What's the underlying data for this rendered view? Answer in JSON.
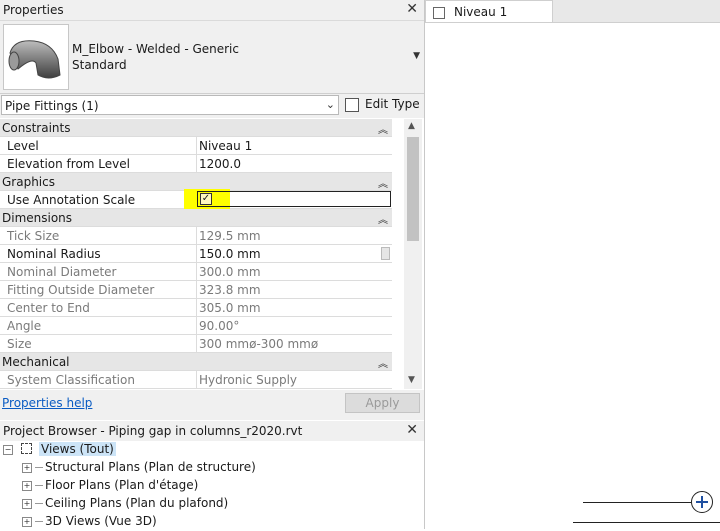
{
  "properties": {
    "title": "Properties",
    "type_name_line1": "M_Elbow - Welded - Generic",
    "type_name_line2": "Standard",
    "filter": "Pipe Fittings (1)",
    "edit_type": "Edit Type",
    "help": "Properties help",
    "apply": "Apply",
    "groups": {
      "constraints": "Constraints",
      "graphics": "Graphics",
      "dimensions": "Dimensions",
      "mechanical": "Mechanical"
    },
    "rows": {
      "level": {
        "name": "Level",
        "value": "Niveau 1"
      },
      "elevation": {
        "name": "Elevation from Level",
        "value": "1200.0"
      },
      "annotation_scale": {
        "name": "Use Annotation Scale",
        "checked": true
      },
      "tick_size": {
        "name": "Tick Size",
        "value": "129.5 mm"
      },
      "nominal_radius": {
        "name": "Nominal Radius",
        "value": "150.0 mm"
      },
      "nominal_diameter": {
        "name": "Nominal Diameter",
        "value": "300.0 mm"
      },
      "fitting_outside_diameter": {
        "name": "Fitting Outside Diameter",
        "value": "323.8 mm"
      },
      "center_to_end": {
        "name": "Center to End",
        "value": "305.0 mm"
      },
      "angle": {
        "name": "Angle",
        "value": "90.00°"
      },
      "size": {
        "name": "Size",
        "value": "300 mmø-300 mmø"
      },
      "system_classification": {
        "name": "System Classification",
        "value": "Hydronic Supply"
      }
    },
    "collapse_glyph": "⌃"
  },
  "browser": {
    "title": "Project Browser - Piping gap in columns_r2020.rvt",
    "root": "Views (Tout)",
    "items": [
      "Structural Plans (Plan de structure)",
      "Floor Plans (Plan d'étage)",
      "Ceiling Plans (Plan du plafond)",
      "3D Views (Vue 3D)"
    ]
  },
  "view": {
    "tab_label": "Niveau 1"
  },
  "colors": {
    "highlight": "#ffff00",
    "link": "#0b5cc3"
  }
}
